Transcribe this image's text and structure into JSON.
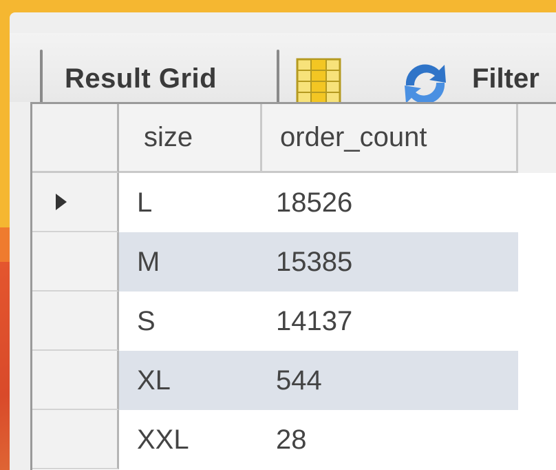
{
  "toolbar": {
    "result_grid_label": "Result Grid",
    "filter_label": "Filter",
    "icons": [
      "grid-view-icon",
      "refresh-icon"
    ]
  },
  "grid": {
    "columns": [
      "size",
      "order_count"
    ],
    "rows": [
      {
        "size": "L",
        "order_count": "18526"
      },
      {
        "size": "M",
        "order_count": "15385"
      },
      {
        "size": "S",
        "order_count": "14137"
      },
      {
        "size": "XL",
        "order_count": "544"
      },
      {
        "size": "XXL",
        "order_count": "28"
      }
    ],
    "selected_row": 0
  },
  "colors": {
    "background": "#f5b731",
    "alt_row": "#dde2ea"
  }
}
